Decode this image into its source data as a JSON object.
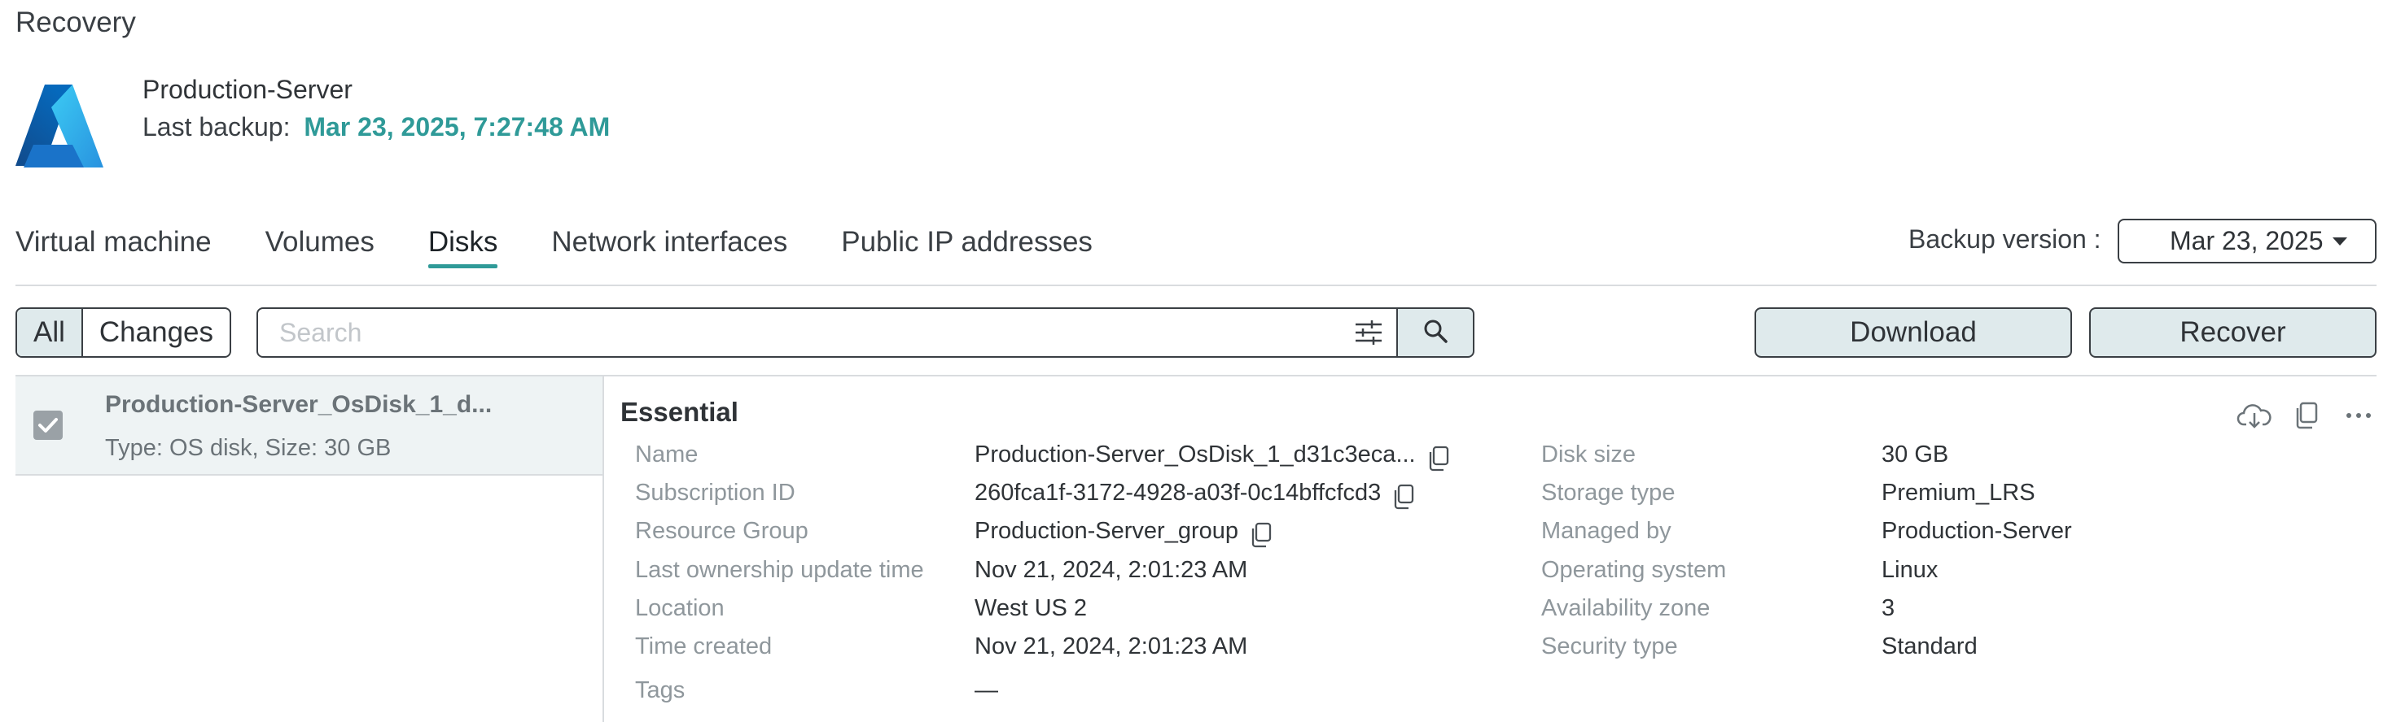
{
  "page": {
    "title": "Recovery"
  },
  "vm": {
    "name": "Production-Server",
    "last_backup_label": "Last backup:",
    "last_backup_value": "Mar 23, 2025, 7:27:48 AM"
  },
  "tabs": [
    {
      "label": "Virtual machine",
      "active": false
    },
    {
      "label": "Volumes",
      "active": false
    },
    {
      "label": "Disks",
      "active": true
    },
    {
      "label": "Network interfaces",
      "active": false
    },
    {
      "label": "Public IP addresses",
      "active": false
    }
  ],
  "backup_version": {
    "label": "Backup version :",
    "selected": "Mar 23, 2025"
  },
  "filter": {
    "all_label": "All",
    "changes_label": "Changes"
  },
  "search": {
    "placeholder": "Search"
  },
  "actions": {
    "download_label": "Download",
    "recover_label": "Recover"
  },
  "disks": [
    {
      "title": "Production-Server_OsDisk_1_d...",
      "subtitle": "Type: OS disk, Size: 30 GB",
      "checked": true
    }
  ],
  "essential": {
    "title": "Essential",
    "left": [
      {
        "key": "Name",
        "value": "Production-Server_OsDisk_1_d31c3eca...",
        "copy": true
      },
      {
        "key": "Subscription ID",
        "value": "260fca1f-3172-4928-a03f-0c14bffcfcd3",
        "copy": true
      },
      {
        "key": "Resource Group",
        "value": "Production-Server_group",
        "copy": true
      },
      {
        "key": "Last ownership update time",
        "value": "Nov 21, 2024, 2:01:23 AM",
        "copy": false
      },
      {
        "key": "Location",
        "value": "West US 2",
        "copy": false
      },
      {
        "key": "Time created",
        "value": "Nov 21, 2024, 2:01:23 AM",
        "copy": false
      },
      {
        "key": "Tags",
        "value": "—",
        "copy": false
      }
    ],
    "right": [
      {
        "key": "Disk size",
        "value": "30 GB"
      },
      {
        "key": "Storage type",
        "value": "Premium_LRS"
      },
      {
        "key": "Managed by",
        "value": "Production-Server"
      },
      {
        "key": "Operating system",
        "value": "Linux"
      },
      {
        "key": "Availability zone",
        "value": "3"
      },
      {
        "key": "Security type",
        "value": "Standard"
      }
    ]
  },
  "colors": {
    "accent": "#2f9a98",
    "button_bg": "#dfeaec",
    "border": "#3a3f44"
  }
}
